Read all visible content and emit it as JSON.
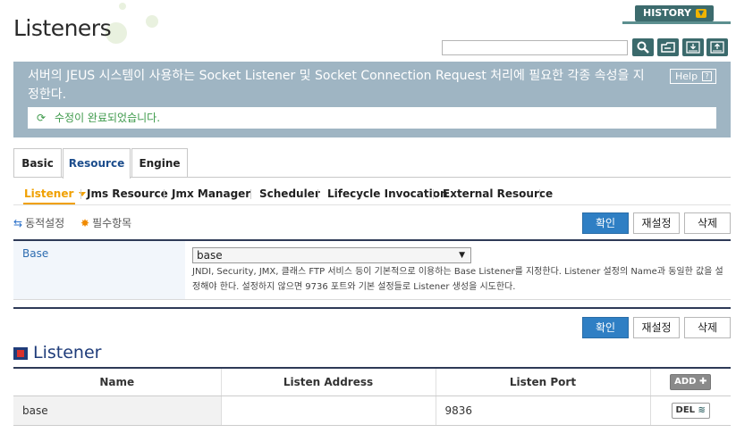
{
  "app": {
    "title": "Listeners",
    "history_label": "HISTORY"
  },
  "search": {
    "value": "",
    "placeholder": ""
  },
  "info": {
    "description": "서버의 JEUS 시스템이 사용하는 Socket Listener 및 Socket Connection Request 처리에 필요한 각종 속성을 지정한다.",
    "help_label": "Help",
    "status_message": "수정이 완료되었습니다."
  },
  "tabs": [
    {
      "label": "Basic"
    },
    {
      "label": "Resource"
    },
    {
      "label": "Engine"
    }
  ],
  "subnav": [
    {
      "label": "Listener"
    },
    {
      "label": "Jms Resource"
    },
    {
      "label": "Jmx Manager"
    },
    {
      "label": "Scheduler"
    },
    {
      "label": "Lifecycle Invocation"
    },
    {
      "label": "External Resource"
    }
  ],
  "legend": {
    "dynamic": "동적설정",
    "required": "필수항목"
  },
  "actions": {
    "confirm": "확인",
    "reset": "재설정",
    "delete": "삭제"
  },
  "form": {
    "base_label": "Base",
    "base_value": "base",
    "base_description": "JNDI, Security, JMX, 클래스 FTP 서비스 등이 기본적으로 이용하는 Base Listener를 지정한다. Listener 설정의 Name과 동일한 값을 설정해야 한다. 설정하지 않으면 9736 포트와 기본 설정들로 Listener 생성을 시도한다."
  },
  "listener_section": {
    "title": "Listener",
    "columns": [
      "Name",
      "Listen Address",
      "Listen Port"
    ],
    "add_label": "ADD",
    "del_label": "DEL",
    "rows": [
      {
        "name": "base",
        "address": "",
        "port": "9836"
      }
    ]
  },
  "colors": {
    "accent": "#2f7fc4",
    "header_bar": "#9fb5c3",
    "history_bg": "#3c6b6d",
    "active_subnav": "#f0a000",
    "status_green": "#3e9a4b"
  }
}
